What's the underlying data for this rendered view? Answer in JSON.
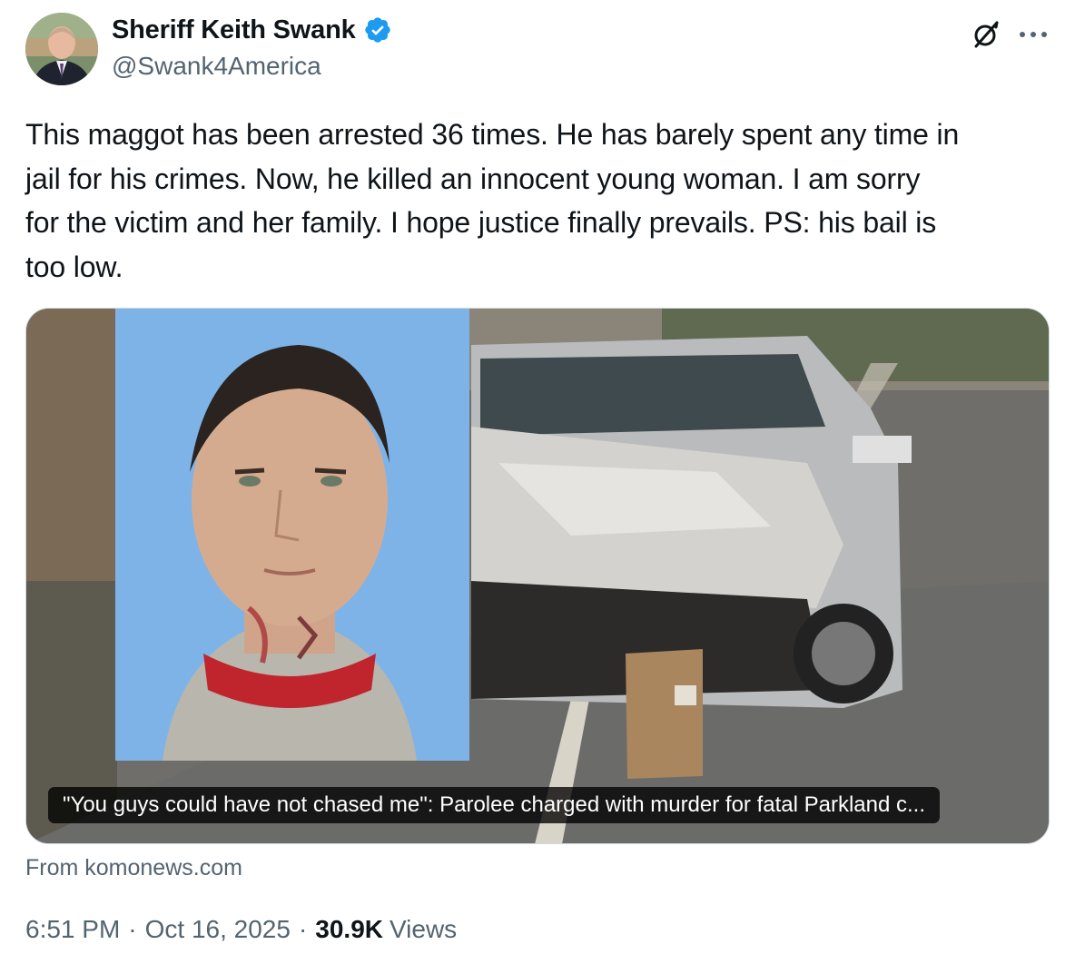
{
  "author": {
    "display_name": "Sheriff Keith Swank",
    "handle": "@Swank4America",
    "verified": true,
    "verified_color": "#1d9bf0"
  },
  "icons": {
    "grok": "grok-icon",
    "more": "more-options-icon",
    "verified": "verified-badge-icon"
  },
  "tweet": {
    "text_lines": [
      "This maggot has been arrested 36 times. He has barely spent any time in",
      "jail for his crimes. Now, he killed an innocent young woman. I am sorry",
      "for the victim and her family. I hope justice finally prevails. PS: his bail is",
      "too low."
    ]
  },
  "card": {
    "caption": "\"You guys could have not chased me\": Parolee charged with murder for fatal Parkland c...",
    "source": "From komonews.com"
  },
  "meta": {
    "time": "6:51 PM",
    "separator": "·",
    "date": "Oct 16, 2025",
    "views_count": "30.9K",
    "views_label": "Views"
  },
  "colors": {
    "text_primary": "#0f1419",
    "text_secondary": "#536471",
    "border": "#cfd9de"
  }
}
